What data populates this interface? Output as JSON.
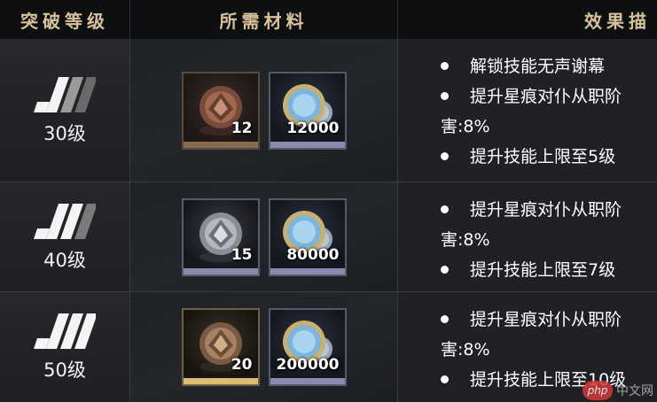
{
  "header": {
    "col_level": "突破等级",
    "col_materials": "所需材料",
    "col_effect": "效果描"
  },
  "rows": [
    {
      "level": "30级",
      "materials": [
        {
          "type": "bronze-emblem",
          "qty": "12"
        },
        {
          "type": "coin",
          "qty": "12000"
        }
      ],
      "effects": [
        {
          "text": "解锁技能无声谢幕"
        },
        {
          "text": "提升星痕对仆从职阶",
          "cont": "害:8%"
        },
        {
          "text": "提升技能上限至5级"
        }
      ]
    },
    {
      "level": "40级",
      "materials": [
        {
          "type": "silver-emblem",
          "qty": "15"
        },
        {
          "type": "coin",
          "qty": "80000"
        }
      ],
      "effects": [
        {
          "text": "提升星痕对仆从职阶",
          "cont": "害:8%"
        },
        {
          "text": "提升技能上限至7级"
        }
      ]
    },
    {
      "level": "50级",
      "materials": [
        {
          "type": "gold-emblem",
          "qty": "20"
        },
        {
          "type": "coin",
          "qty": "200000"
        }
      ],
      "effects": [
        {
          "text": "提升星痕对仆从职阶",
          "cont": "害:8%"
        },
        {
          "text": "提升技能上限至10级"
        }
      ]
    }
  ],
  "watermark": {
    "badge": "php",
    "text": "中文网"
  },
  "colors": {
    "header_text": "#d8c29c",
    "bronze_bar": "#8a6a50",
    "silver_bar": "#8a8ab0",
    "gold_bar": "#d8c070"
  }
}
